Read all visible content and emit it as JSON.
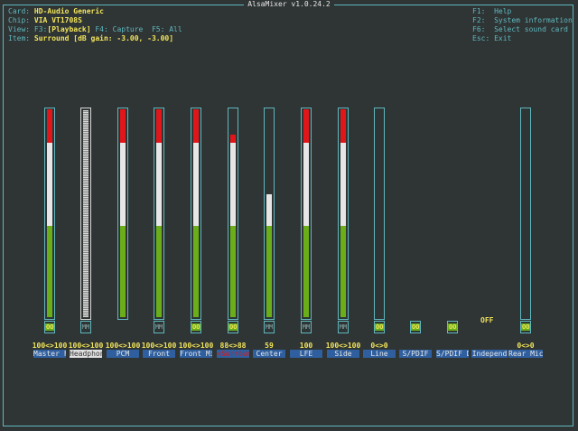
{
  "title": "AlsaMixer v1.0.24.2",
  "info": {
    "card_k": "Card:",
    "card_v": "HD-Audio Generic",
    "chip_k": "Chip:",
    "chip_v": "VIA VT1708S",
    "view_k": "View:",
    "view_f3": "F3:",
    "view_v": "[Playback]",
    "view_rest": " F4: Capture  F5: All",
    "item_k": "Item:",
    "item_v": "Surround [dB gain: -3.00, -3.00]"
  },
  "help": {
    "f1": "F1:  Help",
    "f2": "F2:  System information",
    "f6": "F6:  Select sound card",
    "esc": "Esc: Exit"
  },
  "controls": [
    {
      "label": "Master F",
      "value": "100<>100",
      "mute": "OO",
      "level": 100
    },
    {
      "label": "Headphon",
      "value": "100<>100",
      "mute": "MM",
      "level": 100
    },
    {
      "label": "PCM",
      "value": "100<>100",
      "mute": "",
      "level": 100
    },
    {
      "label": "Front",
      "value": "100<>100",
      "mute": "MM",
      "level": 100
    },
    {
      "label": "Front Mi",
      "value": "100<>100",
      "mute": "OO",
      "level": 100
    },
    {
      "label": "Surround",
      "value": "88<>88",
      "mute": "OO",
      "level": 88
    },
    {
      "label": "Center",
      "value": "59",
      "mute": "MM",
      "level": 59
    },
    {
      "label": "LFE",
      "value": "100",
      "mute": "MM",
      "level": 100
    },
    {
      "label": "Side",
      "value": "100<>100",
      "mute": "MM",
      "level": 100
    },
    {
      "label": "Line",
      "value": "0<>0",
      "mute": "OO",
      "level": 0
    },
    {
      "label": "S/PDIF",
      "value": "",
      "mute": "OO",
      "level": null
    },
    {
      "label": "S/PDIF D",
      "value": "",
      "mute": "OO",
      "level": null
    },
    {
      "label": "Independ",
      "value": "",
      "mute": "OFF",
      "level": null
    },
    {
      "label": "Rear Mic",
      "value": "0<>0",
      "mute": "OO",
      "level": 0
    }
  ],
  "colors": {
    "border": "#5fb8bf",
    "green": "#6aae1a",
    "white": "#e6e6e6",
    "red": "#e0161a",
    "label_bg": "#2f5f9e"
  }
}
